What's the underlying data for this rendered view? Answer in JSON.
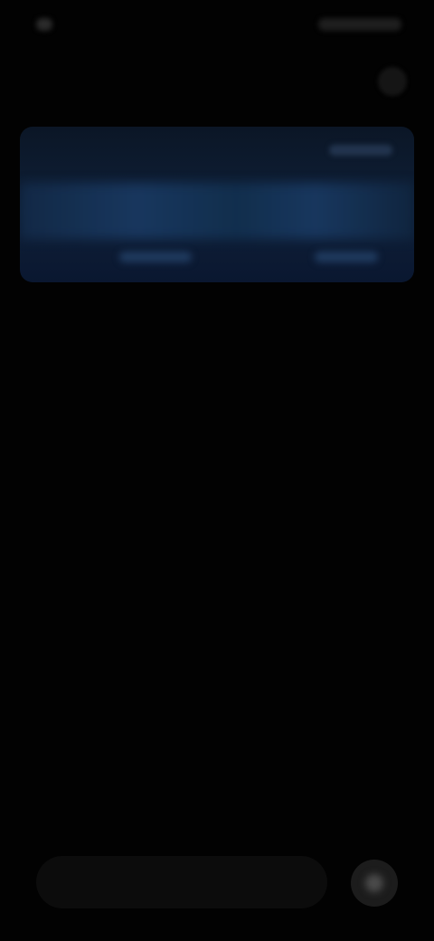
{
  "status_bar": {
    "time": ""
  },
  "header": {
    "title": "",
    "action_icon": "more-icon"
  },
  "card": {
    "label": ""
  },
  "composer": {
    "placeholder": "",
    "send_icon": "send-icon"
  },
  "colors": {
    "background": "#020202",
    "card_top": "#0b1626",
    "card_accent": "#1a3a63"
  }
}
